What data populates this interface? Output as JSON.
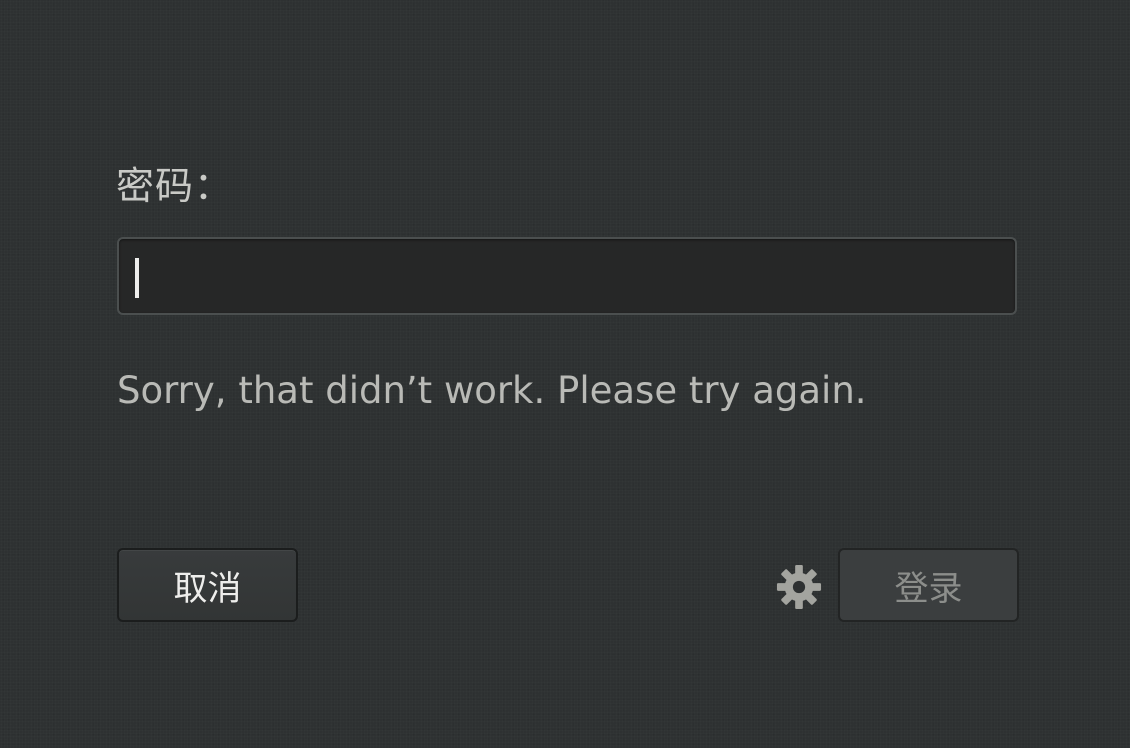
{
  "auth_dialog": {
    "password_label": "密码：",
    "password_value": "",
    "error_message": "Sorry, that didn’t work. Please try again.",
    "cancel_label": "取消",
    "login_label": "登录",
    "session_icon": "gear-icon"
  },
  "colors": {
    "background": "#2e3132",
    "field_background": "#262727",
    "text": "#c9cac6",
    "disabled_text": "#8c8e8b"
  }
}
